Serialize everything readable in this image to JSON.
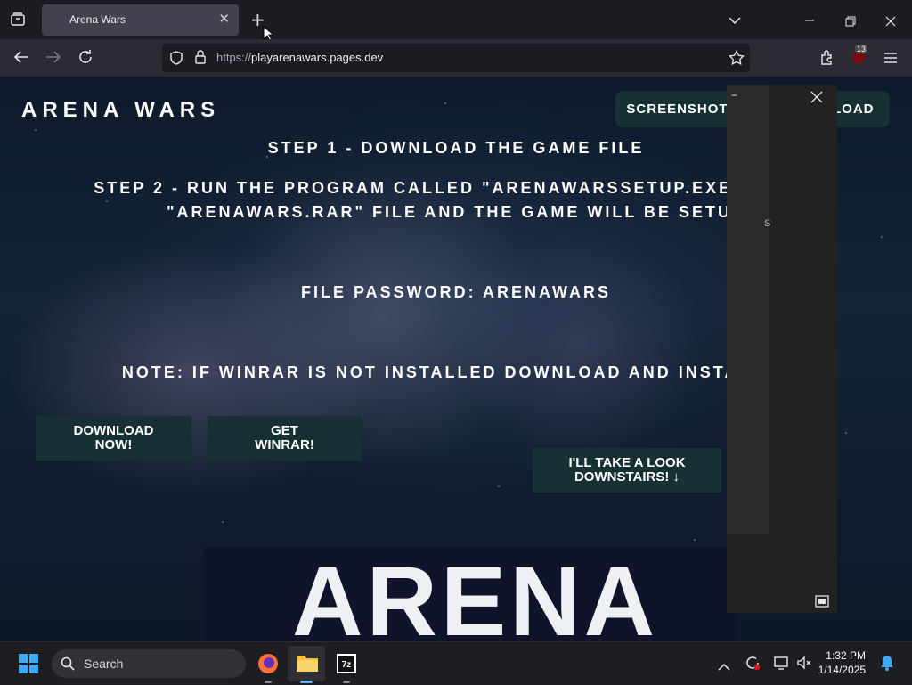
{
  "browser": {
    "tab_title": "Arena Wars",
    "url_protocol": "https://",
    "url_host": "playarenawars.pages.dev",
    "extension_badge": "13"
  },
  "site": {
    "title": "ARENA WARS",
    "header_buttons": [
      "SCREENSHOTS",
      "DOWNLOAD"
    ],
    "step1": "STEP 1 - DOWNLOAD THE GAME FILE",
    "step2_line1": "STEP 2 - RUN THE PROGRAM CALLED \"ARENAWARSSETUP.EXE\" IN THE",
    "step2_line2": "\"ARENAWARS.RAR\" FILE AND THE GAME WILL BE SETUP",
    "password": "FILE PASSWORD: ARENAWARS",
    "note": "NOTE: IF WINRAR IS NOT INSTALLED DOWNLOAD AND INSTALL IT",
    "btn_download": "DOWNLOAD NOW!",
    "btn_winrar": "GET WINRAR!",
    "btn_downstairs": "I'LL TAKE A LOOK DOWNSTAIRS! ↓",
    "logo_text": "ARENA"
  },
  "overlay": {
    "side_letter": "S"
  },
  "taskbar": {
    "search_label": "Search",
    "time": "1:32 PM",
    "date": "1/14/2025"
  }
}
